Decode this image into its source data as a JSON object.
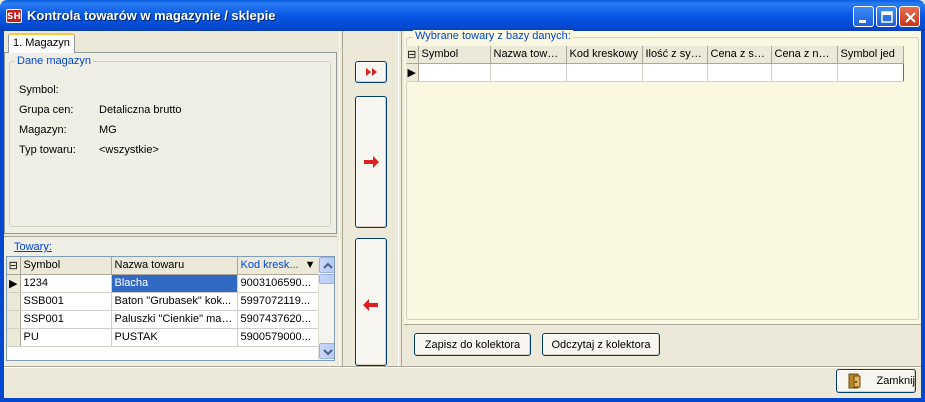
{
  "window": {
    "title": "Kontrola towarów w magazynie / sklepie",
    "app_icon_text": "SH"
  },
  "tabs": [
    {
      "label": "1. Magazyn"
    }
  ],
  "magazyn_group": {
    "legend": "Dane magazyn",
    "fields": [
      {
        "label": "Symbol:",
        "value": ""
      },
      {
        "label": "Grupa cen:",
        "value": "Detaliczna brutto"
      },
      {
        "label": "Magazyn:",
        "value": "MG"
      },
      {
        "label": "Typ towaru:",
        "value": "<wszystkie>"
      }
    ]
  },
  "towary": {
    "legend": "Towary:",
    "columns": [
      "Symbol",
      "Nazwa towaru",
      "Kod kresk..."
    ],
    "rows": [
      [
        "1234",
        "Blacha",
        "9003106590..."
      ],
      [
        "SSB001",
        "Baton \"Grubasek\" kok...",
        "5997072119..."
      ],
      [
        "SSP001",
        "Paluszki \"Cienkie\" mak...",
        "5907437620..."
      ],
      [
        "PU",
        "PUSTAK",
        "5900579000..."
      ]
    ],
    "selected_row": 0,
    "sort_column": 2
  },
  "selected_goods": {
    "legend": "Wybrane towary z bazy danych:",
    "columns": [
      "Symbol",
      "Nazwa towaru",
      "Kod kreskowy",
      "Ilość z sys...",
      "Cena z sy...",
      "Cena z na...",
      "Symbol jed"
    ]
  },
  "buttons": {
    "add_all": "add-all-icon",
    "add": "arrow-right-icon",
    "remove": "arrow-left-icon",
    "save_collector": "Zapisz do kolektora",
    "read_collector": "Odczytaj z kolektora",
    "close": "Zamknij"
  },
  "colors": {
    "title_bar": "#0a5fe0",
    "legend_text": "#0046d5",
    "selection": "#316ac5",
    "row_highlight": "#e04040",
    "right_panel_bg": "#fbf8e2"
  }
}
